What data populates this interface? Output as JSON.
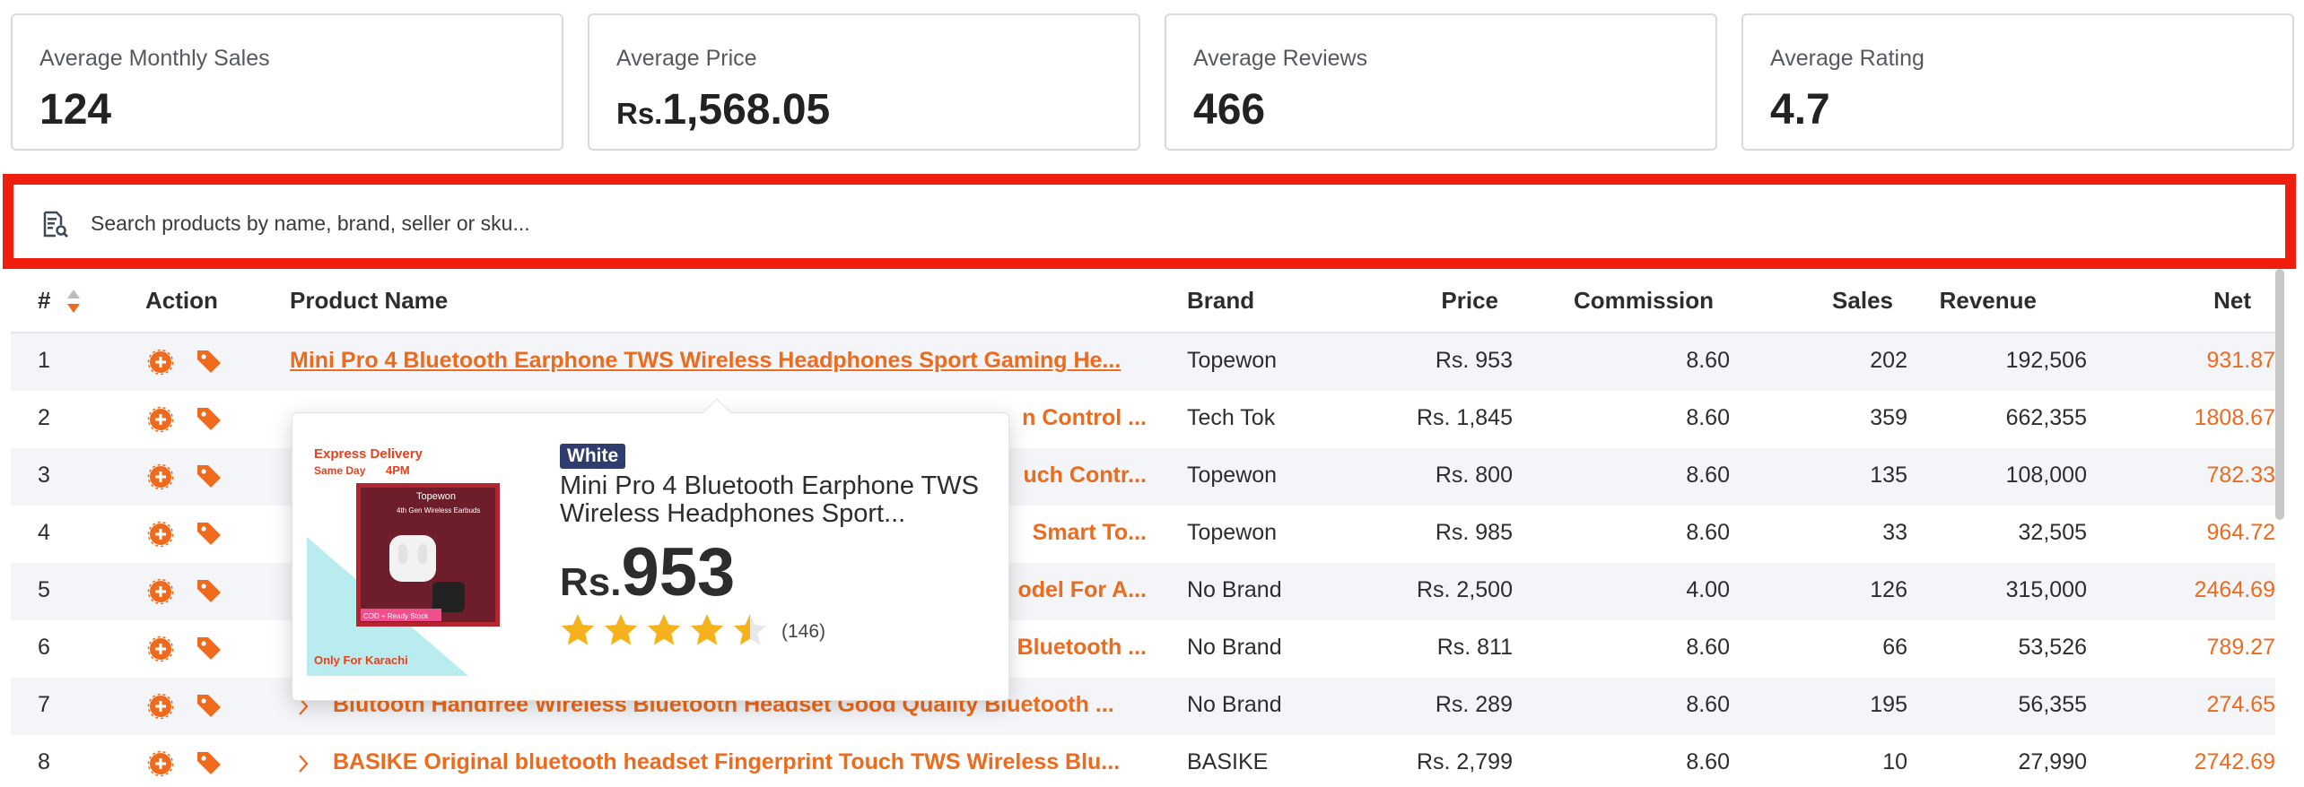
{
  "stats": [
    {
      "label": "Average Monthly Sales",
      "value": "124",
      "currency": ""
    },
    {
      "label": "Average Price",
      "value": "1,568.05",
      "currency": "Rs."
    },
    {
      "label": "Average Reviews",
      "value": "466",
      "currency": ""
    },
    {
      "label": "Average Rating",
      "value": "4.7",
      "currency": ""
    }
  ],
  "search": {
    "placeholder": "Search products by name, brand, seller or sku..."
  },
  "table": {
    "headers": {
      "num": "#",
      "action": "Action",
      "product": "Product Name",
      "brand": "Brand",
      "price": "Price",
      "commission": "Commission",
      "sales": "Sales",
      "revenue": "Revenue",
      "net": "Net"
    },
    "rows": [
      {
        "num": "1",
        "name": "Mini Pro 4 Bluetooth Earphone TWS Wireless Headphones Sport Gaming He...",
        "brand": "Topewon",
        "price": "Rs. 953",
        "commission": "8.60",
        "sales": "202",
        "revenue": "192,506",
        "net": "931.87"
      },
      {
        "num": "2",
        "name": "n Control ...",
        "brand": "Tech Tok",
        "price": "Rs. 1,845",
        "commission": "8.60",
        "sales": "359",
        "revenue": "662,355",
        "net": "1808.67"
      },
      {
        "num": "3",
        "name": "uch Contr...",
        "brand": "Topewon",
        "price": "Rs. 800",
        "commission": "8.60",
        "sales": "135",
        "revenue": "108,000",
        "net": "782.33"
      },
      {
        "num": "4",
        "name": "Smart To...",
        "brand": "Topewon",
        "price": "Rs. 985",
        "commission": "8.60",
        "sales": "33",
        "revenue": "32,505",
        "net": "964.72"
      },
      {
        "num": "5",
        "name": "odel For A...",
        "brand": "No Brand",
        "price": "Rs. 2,500",
        "commission": "4.00",
        "sales": "126",
        "revenue": "315,000",
        "net": "2464.69"
      },
      {
        "num": "6",
        "name": "Bluetooth ...",
        "brand": "No Brand",
        "price": "Rs. 811",
        "commission": "8.60",
        "sales": "66",
        "revenue": "53,526",
        "net": "789.27"
      },
      {
        "num": "7",
        "name": "Blutooth Handfree Wireless Bluetooth Headset Good Quality Bluetooth ...",
        "brand": "No Brand",
        "price": "Rs. 289",
        "commission": "8.60",
        "sales": "195",
        "revenue": "56,355",
        "net": "274.65"
      },
      {
        "num": "8",
        "name": "BASIKE Original bluetooth headset Fingerprint Touch TWS Wireless Blu...",
        "brand": "BASIKE",
        "price": "Rs. 2,799",
        "commission": "8.60",
        "sales": "10",
        "revenue": "27,990",
        "net": "2742.69"
      }
    ]
  },
  "popup": {
    "variant": "White",
    "title": "Mini Pro 4 Bluetooth Earphone TWS Wireless Headphones Sport...",
    "currency": "Rs.",
    "price": "953",
    "rating": 4.5,
    "review_count": "(146)",
    "image_texts": {
      "top": "Express Delivery",
      "sub": "Same Day",
      "time": "4PM",
      "brand": "Topewon",
      "gen": "4th Gen Wireless Earbuds",
      "cod": "COD + Ready Stock",
      "bottom": "Only For Karachi"
    }
  },
  "colors": {
    "accent": "#ee6a1c",
    "highlight_border": "#f01e0e",
    "badge": "#2f3c6e",
    "star": "#f5b21a"
  }
}
